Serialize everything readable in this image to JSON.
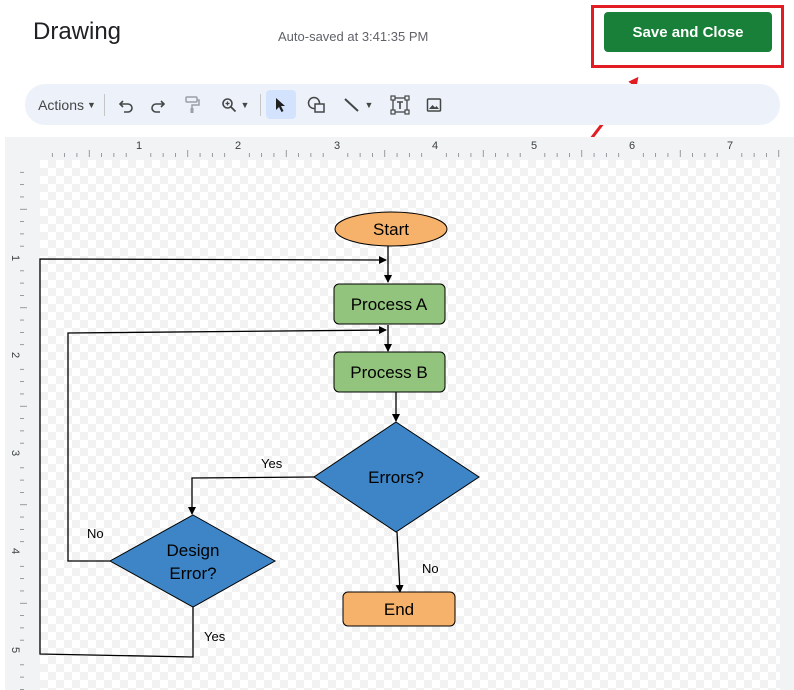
{
  "header": {
    "title": "Drawing",
    "autosave": "Auto-saved at 3:41:35 PM",
    "save_button": "Save and Close"
  },
  "toolbar": {
    "actions_label": "Actions",
    "icons": [
      "undo-icon",
      "redo-icon",
      "paint-format-icon",
      "zoom-icon",
      "select-icon",
      "shape-icon",
      "line-icon",
      "text-box-icon",
      "image-icon"
    ]
  },
  "ruler": {
    "top_labels": [
      "1",
      "2",
      "3",
      "4",
      "5",
      "6",
      "7"
    ],
    "left_labels": [
      "1",
      "2",
      "3",
      "4",
      "5"
    ]
  },
  "flowchart": {
    "start": "Start",
    "process_a": "Process A",
    "process_b": "Process B",
    "errors": "Errors?",
    "design_error_line1": "Design",
    "design_error_line2": "Error?",
    "end": "End",
    "yes_errors": "Yes",
    "no_errors": "No",
    "no_design": "No",
    "yes_design": "Yes"
  },
  "colors": {
    "save_button": "#188038",
    "highlight": "#e31b23",
    "terminal_fill": "#f6b26b",
    "process_fill": "#93c47d",
    "decision_fill": "#3d85c6"
  }
}
